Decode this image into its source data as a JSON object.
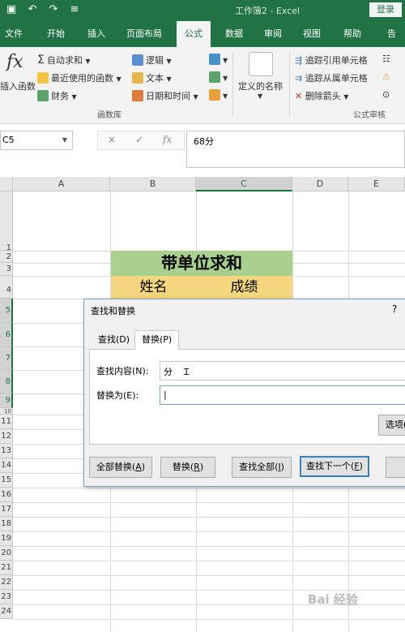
{
  "titlebar": {
    "doc_title": "工作簿2 - Excel",
    "login_label": "登录",
    "qat": [
      "save-icon",
      "undo-icon",
      "redo-icon",
      "customize-icon"
    ]
  },
  "menu": {
    "tabs": [
      "文件",
      "开始",
      "插入",
      "页面布局",
      "公式",
      "数据",
      "审阅",
      "视图",
      "帮助",
      "告"
    ],
    "active": "公式"
  },
  "ribbon": {
    "insert_function": "插入函数",
    "fx": "fx",
    "autosum": "自动求和",
    "recent": "最近使用的函数",
    "financial": "财务",
    "logical": "逻辑",
    "text": "文本",
    "datetime": "日期和时间",
    "function_library": "函数库",
    "defined_names": "定义的名称",
    "trace_precedents": "追踪引用单元格",
    "trace_dependents": "追踪从属单元格",
    "remove_arrows": "删除箭头",
    "formula_auditing": "公式审核"
  },
  "formula_bar": {
    "name_box": "C5",
    "cancel": "×",
    "enter": "✓",
    "fx": "fx",
    "value": "68分"
  },
  "sheet": {
    "columns": [
      "A",
      "B",
      "C",
      "D",
      "E"
    ],
    "selected_column": "C",
    "rows": [
      "1",
      "2",
      "3",
      "4",
      "5",
      "6",
      "7",
      "8",
      "9",
      "10",
      "11",
      "12",
      "13",
      "14",
      "15",
      "16",
      "17",
      "18",
      "19",
      "20",
      "21",
      "22",
      "23",
      "24"
    ],
    "title_cell": "带单位求和",
    "header_name": "姓名",
    "header_score": "成绩"
  },
  "dialog": {
    "title": "查找和替换",
    "help": "?",
    "tab_find": "查找(D)",
    "tab_replace": "替换(P)",
    "find_label": "查找内容(N):",
    "find_value": "分",
    "replace_label": "替换为(E):",
    "replace_value": "",
    "options_button": "选项(",
    "replace_all_button": "全部替换(A)",
    "replace_button": "替换(R)",
    "find_all_button": "查找全部(I)",
    "find_next_button": "查找下一个(F)"
  },
  "watermark": "Bai 经验"
}
